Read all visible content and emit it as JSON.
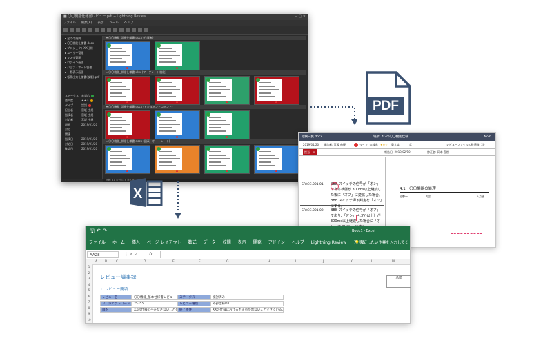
{
  "dark_app": {
    "title": "■ 〇〇機能仕様書レビュー.pdf ─ Lightning Review",
    "menu": [
      "ファイル",
      "編集(E)",
      "表示",
      "ツール",
      "ヘルプ"
    ],
    "tree_items": [
      "全ての指摘",
      "〇〇機能仕様書 docx",
      "プロジェクトXX仕様",
      "ユーザー管理",
      "マスタ管理",
      "ログイン画面",
      "ジョブ・ポート管理",
      "一覧表示画面",
      "帳票出力仕様書(仮版).pdf"
    ],
    "props": [
      {
        "k": "ステータス",
        "v": "未対応"
      },
      {
        "k": "重大度",
        "v": "★★☆"
      },
      {
        "k": "タイプ",
        "v": "誤記"
      },
      {
        "k": "担当者",
        "v": "宮坂 由規"
      },
      {
        "k": "指摘者",
        "v": "宮坂 由規"
      },
      {
        "k": "対応者",
        "v": "宮坂 由規"
      },
      {
        "k": "期限",
        "v": "2019/01/20"
      },
      {
        "k": "対応",
        "v": ""
      },
      {
        "k": "関連",
        "v": ""
      },
      {
        "k": "指摘日",
        "v": "2019/01/20"
      },
      {
        "k": "対応日",
        "v": "2019/01/20"
      },
      {
        "k": "確認日",
        "v": "2019/01/20"
      }
    ],
    "groups": [
      {
        "label": "〇〇機能_詳細仕様書.docx (作業者)",
        "thumbs": [
          "#2f7dd1",
          "#22a06b"
        ]
      },
      {
        "label": "〇〇機能_詳細仕様書.xlsx (ワークシート機能)",
        "thumbs": [
          "#b5121b",
          "#b5121b",
          "#2ea06b",
          "#b5121b"
        ]
      },
      {
        "label": "〇〇機能_詳細仕様書.docx (ドキュメントコメント)",
        "thumbs": [
          "#b5121b",
          "#2f7dd1",
          "#22a06b"
        ]
      },
      {
        "label": "〇〇機能_詳細仕様書.docx (図表・ポートレート)",
        "thumbs": [
          "#2f7dd1",
          "#e8832a",
          "#22a06b",
          "#2f7dd1"
        ]
      }
    ],
    "status_bar": "指摘: 41   未対応: 8   対応済: 33   完了"
  },
  "pdf_icon": {
    "label": "PDF",
    "color": "#3b5170"
  },
  "pdf_viewer": {
    "title_left": "指摘一覧.docx",
    "title_mid": "場所: 4.2の〇〇機能仕様",
    "title_right": "No.6",
    "row1": [
      "2019/01/20",
      "報告者: 宮坂 由規",
      "ライフ: 未検出",
      "★★☆",
      "重大度",
      "状",
      "レビューファイルの数値数: 20"
    ],
    "row2": [
      "担当・コ",
      "報告日: 2019/02/10",
      "修正者: 岡本 直樹"
    ],
    "left_codes": [
      "SPACC.001.01",
      "SPACC.001.02"
    ],
    "left_text1": [
      "BBB スイッチの信号が「オン」である状態が 300ms以上継続した後に「オフ」に変化した場合、BBB スイッチ押下判定を「オン」にする。"
    ],
    "left_text2": [
      "BBB スイッチの信号が「オフ」であり、「オン」(4.3V)以上）が 300ms以上継続した場合に「オン」(5.0V)以上にする。"
    ],
    "section_heading": "4.1　〇〇機能の処理",
    "small_table_head": [
      "処理No",
      "内容",
      "入力値"
    ]
  },
  "excel": {
    "title_right": "Book1 - Excel",
    "ribbon_tabs": [
      "ファイル",
      "ホーム",
      "挿入",
      "ページ レイアウト",
      "数式",
      "データ",
      "校閲",
      "表示",
      "開発",
      "アドイン",
      "ヘルプ",
      "Lightning Review",
      "チーム"
    ],
    "tell_me": "実行したい作業を入力してください",
    "name_box": "AA28",
    "fx": "fx",
    "columns": [
      "A",
      "B",
      "C",
      "D",
      "E",
      "F",
      "G",
      "H",
      "I",
      "J",
      "K",
      "L",
      "M"
    ],
    "rows": [
      "1",
      "2",
      "3",
      "4",
      "5",
      "6",
      "7",
      "8",
      "9",
      "10"
    ],
    "sheet_title": "レビュー議事録",
    "section": "1. レビュー要領",
    "table": [
      [
        "レビュー名",
        "〇〇機能_基本仕様書レビュー",
        "ステータス",
        "検討済み"
      ],
      [
        "プロジェクトコード",
        "25355",
        "レビュー種別",
        "外部仕様DR"
      ],
      [
        "目的",
        "XXの仕様で不正なさないことを出来る。",
        "終了条件",
        "XXの仕様における不正点が出ないことできている。"
      ]
    ],
    "side_label": "承認",
    "colors": {
      "ribbon": "#217346",
      "header_cell": "#8ea9db"
    }
  },
  "arrow_color": "#3b5170"
}
